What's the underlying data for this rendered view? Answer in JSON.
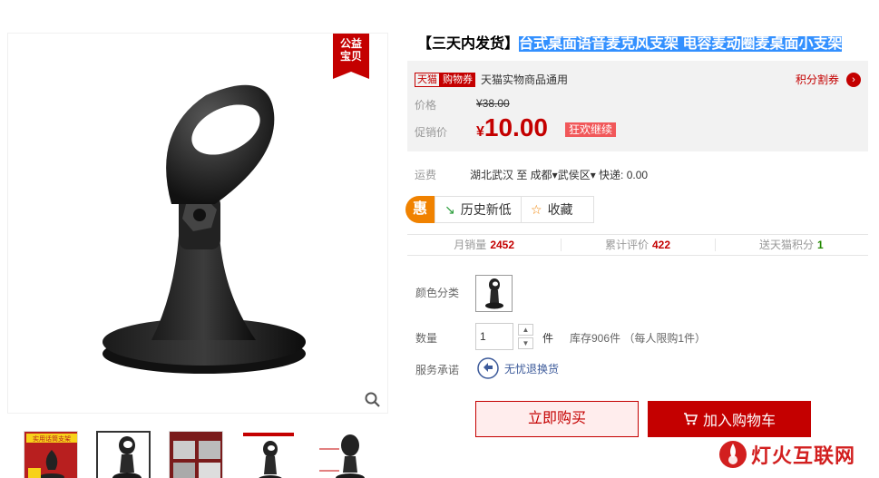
{
  "gallery": {
    "charity_badge": [
      "公益",
      "宝贝"
    ],
    "thumbnails": [
      {
        "name": "thumbnail-1",
        "caption": "实用话筒支架"
      },
      {
        "name": "thumbnail-2"
      },
      {
        "name": "thumbnail-3"
      },
      {
        "name": "thumbnail-4"
      },
      {
        "name": "thumbnail-5"
      }
    ]
  },
  "product": {
    "title_prefix": "【三天内发货】",
    "title_main": "台式桌面语音麦克风支架 电容麦动圈麦桌面小支架"
  },
  "price_box": {
    "tmall_badge": "天猫",
    "coupon_badge": "购物券",
    "promo_text": "天猫实物商品通用",
    "points_link": "积分割券",
    "price_label": "价格",
    "old_price": "¥38.00",
    "sale_label": "促销价",
    "currency": "¥",
    "sale_price": "10.00",
    "sale_tag": "狂欢继续"
  },
  "shipping": {
    "label": "运费",
    "value": "湖北武汉 至 成都▾武侯区▾ 快递: 0.00"
  },
  "actions": {
    "hui": "惠",
    "history_low": "历史新低",
    "favorite": "收藏"
  },
  "stats": {
    "monthly_sales_label": "月销量",
    "monthly_sales": "2452",
    "reviews_label": "累计评价",
    "reviews": "422",
    "points_label": "送天猫积分",
    "points": "1"
  },
  "options": {
    "color_label": "颜色分类",
    "qty_label": "数量",
    "qty_value": "1",
    "qty_unit": "件",
    "stock_text": "库存906件 （每人限购1件）",
    "service_label": "服务承诺",
    "service_text": "无忧退换货"
  },
  "buttons": {
    "buy_now": "立即购买",
    "add_cart": "加入购物车"
  },
  "watermark": "灯火互联网",
  "colors": {
    "brand_red": "#c40000",
    "highlight": "#3390ff",
    "hui_orange": "#f08200"
  }
}
